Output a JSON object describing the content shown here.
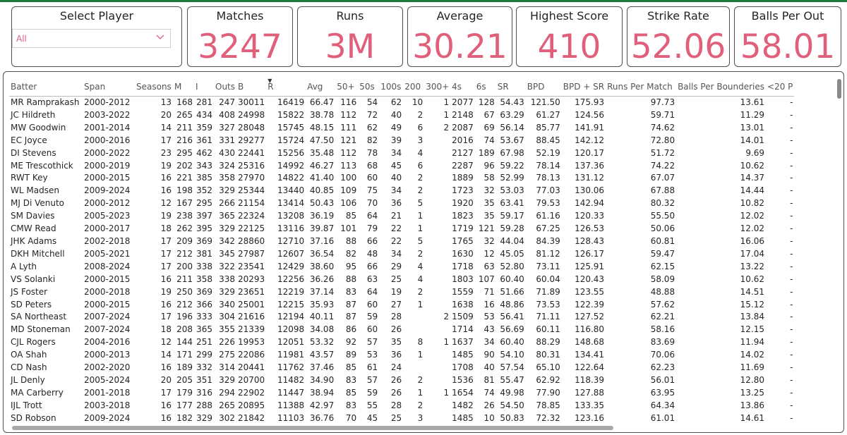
{
  "slicer": {
    "title": "Select Player",
    "value": "All"
  },
  "kpis": [
    {
      "title": "Matches",
      "value": "3247"
    },
    {
      "title": "Runs",
      "value": "3M"
    },
    {
      "title": "Average",
      "value": "30.21"
    },
    {
      "title": "Highest Score",
      "value": "410"
    },
    {
      "title": "Strike Rate",
      "value": "52.06"
    },
    {
      "title": "Balls Per Out",
      "value": "58.01"
    }
  ],
  "colors": {
    "accent": "#e0607b",
    "border": "#505050",
    "text": "#252525"
  },
  "table": {
    "sorted_column": "R",
    "sort_direction": "descending",
    "columns": [
      "Batter",
      "Span",
      "Seasons",
      "M",
      "I",
      "Outs",
      "B",
      "R",
      "Avg",
      "50+",
      "50s",
      "100s",
      "200",
      "300+",
      "4s",
      "6s",
      "SR",
      "BPD",
      "BPD + SR",
      "Runs Per Match",
      "Balls Per Bounderies",
      "<20 P"
    ],
    "rows": [
      [
        "MR Ramprakash",
        "2000-2012",
        "13",
        "168",
        "281",
        "247",
        "30011",
        "16419",
        "66.47",
        "116",
        "54",
        "62",
        "10",
        "1",
        "2077",
        "128",
        "54.43",
        "121.50",
        "175.93",
        "97.73",
        "13.61",
        "-"
      ],
      [
        "JC Hildreth",
        "2003-2022",
        "20",
        "265",
        "434",
        "408",
        "24998",
        "15822",
        "38.78",
        "112",
        "72",
        "40",
        "2",
        "1",
        "2148",
        "67",
        "63.29",
        "61.27",
        "124.56",
        "59.71",
        "11.29",
        "-"
      ],
      [
        "MW Goodwin",
        "2001-2014",
        "14",
        "211",
        "359",
        "327",
        "28048",
        "15745",
        "48.15",
        "111",
        "62",
        "49",
        "6",
        "2",
        "2087",
        "69",
        "56.14",
        "85.77",
        "141.91",
        "74.62",
        "13.01",
        "-"
      ],
      [
        "EC Joyce",
        "2000-2016",
        "17",
        "216",
        "361",
        "331",
        "29277",
        "15724",
        "47.50",
        "121",
        "82",
        "39",
        "3",
        "",
        "2016",
        "74",
        "53.67",
        "88.45",
        "142.12",
        "72.80",
        "14.01",
        "-"
      ],
      [
        "DI Stevens",
        "2000-2022",
        "23",
        "295",
        "462",
        "430",
        "22441",
        "15256",
        "35.48",
        "112",
        "78",
        "34",
        "4",
        "",
        "2127",
        "189",
        "67.98",
        "52.19",
        "120.17",
        "51.72",
        "9.69",
        "-"
      ],
      [
        "ME Trescothick",
        "2000-2019",
        "19",
        "202",
        "343",
        "324",
        "25316",
        "14992",
        "46.27",
        "113",
        "68",
        "45",
        "6",
        "",
        "2287",
        "96",
        "59.22",
        "78.14",
        "137.36",
        "74.22",
        "10.62",
        "-"
      ],
      [
        "RWT Key",
        "2000-2015",
        "16",
        "221",
        "385",
        "358",
        "27970",
        "14822",
        "41.40",
        "100",
        "60",
        "40",
        "2",
        "",
        "1889",
        "58",
        "52.99",
        "78.13",
        "131.12",
        "67.07",
        "14.37",
        "-"
      ],
      [
        "WL Madsen",
        "2009-2024",
        "16",
        "198",
        "352",
        "329",
        "25344",
        "13440",
        "40.85",
        "109",
        "75",
        "34",
        "2",
        "",
        "1723",
        "32",
        "53.03",
        "77.03",
        "130.06",
        "67.88",
        "14.44",
        "-"
      ],
      [
        "MJ Di Venuto",
        "2000-2012",
        "12",
        "167",
        "295",
        "266",
        "21154",
        "13414",
        "50.43",
        "106",
        "70",
        "36",
        "5",
        "",
        "1920",
        "35",
        "63.41",
        "79.53",
        "142.94",
        "80.32",
        "10.82",
        "-"
      ],
      [
        "SM Davies",
        "2005-2023",
        "19",
        "238",
        "397",
        "365",
        "22324",
        "13208",
        "36.19",
        "85",
        "64",
        "21",
        "1",
        "",
        "1823",
        "35",
        "59.17",
        "61.16",
        "120.33",
        "55.50",
        "12.02",
        "-"
      ],
      [
        "CMW Read",
        "2000-2017",
        "18",
        "262",
        "395",
        "329",
        "22125",
        "13116",
        "39.87",
        "101",
        "79",
        "22",
        "1",
        "",
        "1719",
        "121",
        "59.28",
        "67.25",
        "126.53",
        "50.06",
        "12.02",
        "-"
      ],
      [
        "JHK Adams",
        "2002-2018",
        "17",
        "209",
        "369",
        "342",
        "28860",
        "12710",
        "37.16",
        "88",
        "66",
        "22",
        "5",
        "",
        "1765",
        "32",
        "44.04",
        "84.39",
        "128.43",
        "60.81",
        "16.06",
        "-"
      ],
      [
        "DKH Mitchell",
        "2005-2021",
        "17",
        "212",
        "381",
        "345",
        "27987",
        "12607",
        "36.54",
        "82",
        "48",
        "34",
        "2",
        "",
        "1630",
        "12",
        "45.05",
        "81.12",
        "126.17",
        "59.47",
        "17.04",
        "-"
      ],
      [
        "A Lyth",
        "2008-2024",
        "17",
        "200",
        "338",
        "322",
        "23541",
        "12429",
        "38.60",
        "95",
        "66",
        "29",
        "4",
        "",
        "1718",
        "63",
        "52.80",
        "73.11",
        "125.91",
        "62.15",
        "13.22",
        "-"
      ],
      [
        "VS Solanki",
        "2000-2015",
        "16",
        "211",
        "358",
        "338",
        "20293",
        "12256",
        "36.26",
        "88",
        "63",
        "25",
        "4",
        "",
        "1803",
        "107",
        "60.40",
        "60.04",
        "120.43",
        "58.09",
        "10.62",
        "-"
      ],
      [
        "JS Foster",
        "2000-2018",
        "19",
        "250",
        "369",
        "329",
        "23651",
        "12219",
        "37.14",
        "83",
        "64",
        "19",
        "2",
        "",
        "1559",
        "71",
        "51.66",
        "71.89",
        "123.55",
        "48.88",
        "14.51",
        "-"
      ],
      [
        "SD Peters",
        "2000-2015",
        "16",
        "212",
        "366",
        "340",
        "25001",
        "12215",
        "35.93",
        "87",
        "60",
        "27",
        "1",
        "",
        "1638",
        "16",
        "48.86",
        "73.53",
        "122.39",
        "57.62",
        "15.12",
        "-"
      ],
      [
        "SA Northeast",
        "2007-2024",
        "17",
        "196",
        "333",
        "304",
        "21616",
        "12194",
        "40.11",
        "87",
        "59",
        "28",
        "",
        "2",
        "1509",
        "53",
        "56.41",
        "71.11",
        "127.52",
        "62.21",
        "13.84",
        "-"
      ],
      [
        "MD Stoneman",
        "2007-2024",
        "18",
        "208",
        "365",
        "355",
        "21339",
        "12098",
        "34.08",
        "86",
        "60",
        "26",
        "",
        "",
        "1714",
        "43",
        "56.69",
        "60.11",
        "116.80",
        "58.16",
        "12.15",
        "-"
      ],
      [
        "CJL Rogers",
        "2004-2016",
        "12",
        "144",
        "251",
        "226",
        "19953",
        "12051",
        "53.32",
        "92",
        "57",
        "35",
        "8",
        "1",
        "1637",
        "34",
        "60.40",
        "88.29",
        "148.68",
        "83.69",
        "11.94",
        "-"
      ],
      [
        "OA Shah",
        "2000-2013",
        "14",
        "171",
        "299",
        "275",
        "22086",
        "11981",
        "43.57",
        "89",
        "53",
        "36",
        "1",
        "",
        "1485",
        "90",
        "54.10",
        "80.31",
        "134.41",
        "70.06",
        "14.02",
        "-"
      ],
      [
        "CD Nash",
        "2002-2020",
        "16",
        "189",
        "332",
        "314",
        "20441",
        "11762",
        "37.46",
        "85",
        "61",
        "24",
        "",
        "",
        "1708",
        "40",
        "57.54",
        "65.10",
        "122.64",
        "62.23",
        "11.69",
        "-"
      ],
      [
        "JL Denly",
        "2005-2024",
        "20",
        "205",
        "351",
        "329",
        "20700",
        "11482",
        "34.90",
        "83",
        "57",
        "26",
        "2",
        "",
        "1536",
        "81",
        "55.47",
        "62.92",
        "118.39",
        "56.01",
        "12.80",
        "-"
      ],
      [
        "MA Carberry",
        "2001-2018",
        "17",
        "179",
        "316",
        "294",
        "22902",
        "11447",
        "38.94",
        "85",
        "59",
        "26",
        "1",
        "1",
        "1654",
        "74",
        "49.98",
        "77.90",
        "127.88",
        "63.95",
        "13.25",
        "-"
      ],
      [
        "IJL Trott",
        "2003-2018",
        "16",
        "177",
        "288",
        "265",
        "20895",
        "11388",
        "42.97",
        "83",
        "55",
        "28",
        "2",
        "",
        "1482",
        "26",
        "54.50",
        "78.85",
        "133.35",
        "64.34",
        "13.86",
        "-"
      ],
      [
        "SD Robson",
        "2009-2024",
        "16",
        "182",
        "329",
        "302",
        "21842",
        "11103",
        "36.76",
        "70",
        "45",
        "25",
        "3",
        "",
        "1485",
        "10",
        "50.83",
        "72.32",
        "123.16",
        "61.01",
        "14.61",
        "-"
      ]
    ]
  }
}
